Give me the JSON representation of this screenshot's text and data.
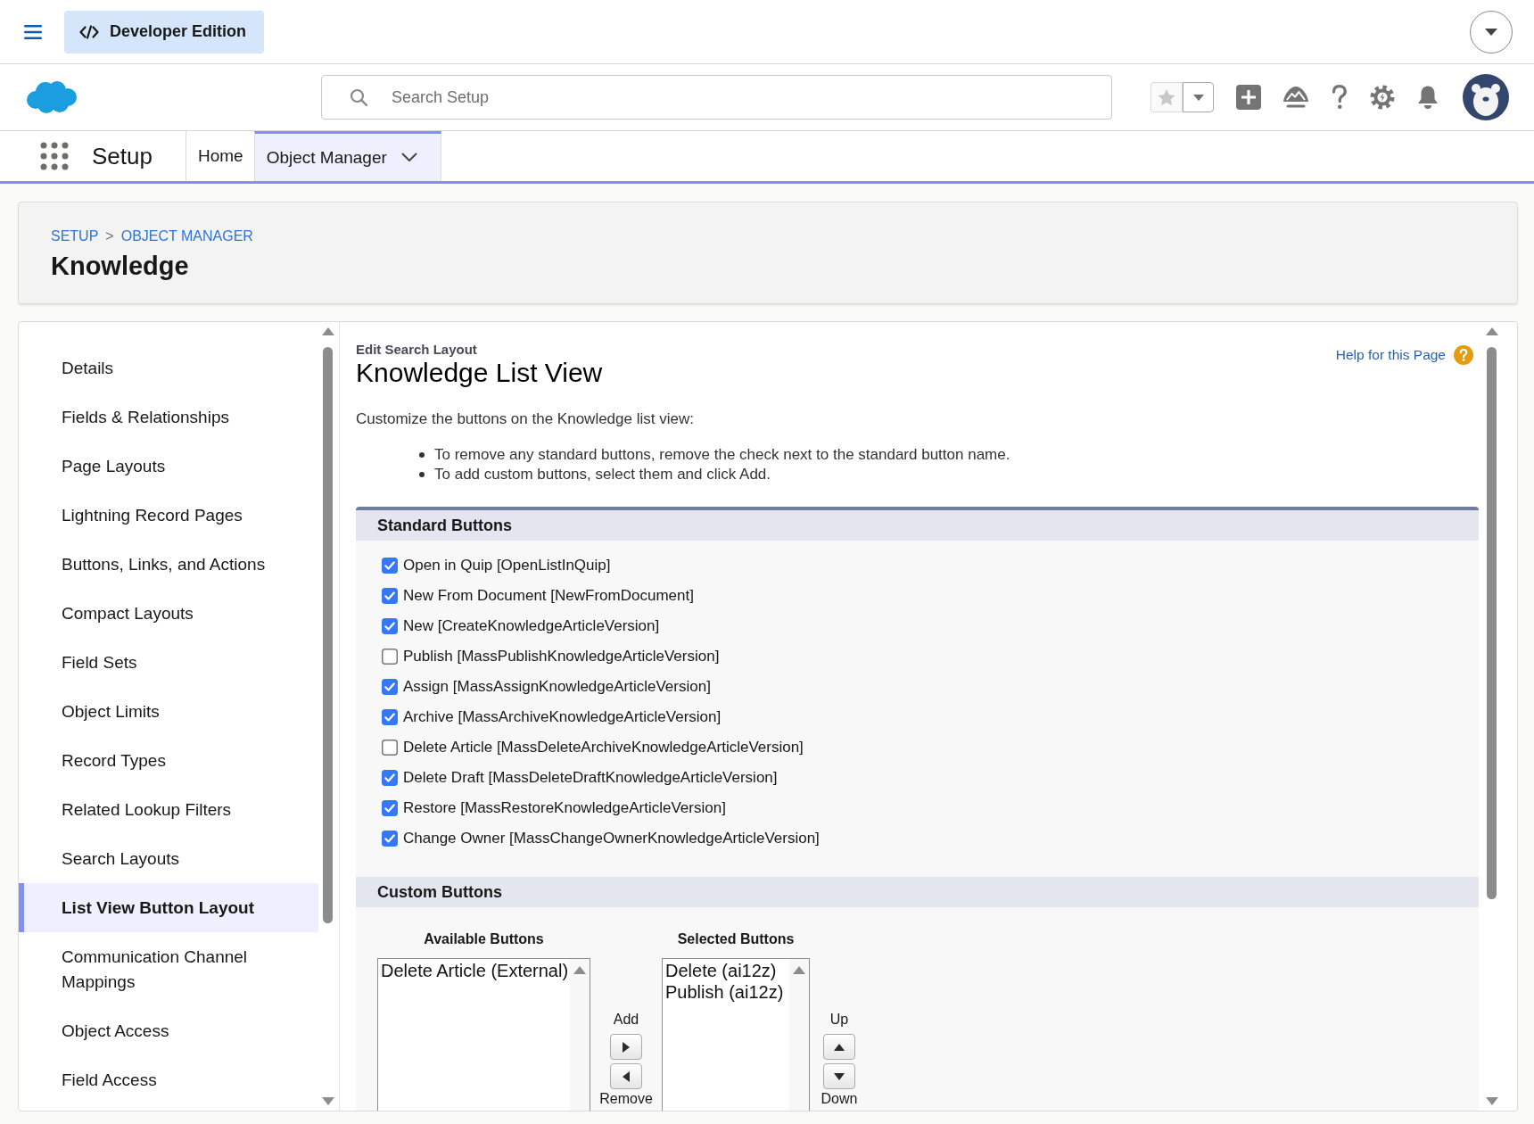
{
  "top_bar": {
    "edition": "Developer Edition"
  },
  "search": {
    "placeholder": "Search Setup"
  },
  "nav": {
    "app_name": "Setup",
    "tabs": [
      {
        "label": "Home",
        "selected": false,
        "dropdown": false
      },
      {
        "label": "Object Manager",
        "selected": true,
        "dropdown": true
      }
    ]
  },
  "page_header": {
    "breadcrumb": {
      "links": [
        "SETUP",
        "OBJECT MANAGER"
      ],
      "separator": ">"
    },
    "title": "Knowledge"
  },
  "sidebar": {
    "items": [
      {
        "label": "Details",
        "selected": false
      },
      {
        "label": "Fields & Relationships",
        "selected": false
      },
      {
        "label": "Page Layouts",
        "selected": false
      },
      {
        "label": "Lightning Record Pages",
        "selected": false
      },
      {
        "label": "Buttons, Links, and Actions",
        "selected": false
      },
      {
        "label": "Compact Layouts",
        "selected": false
      },
      {
        "label": "Field Sets",
        "selected": false
      },
      {
        "label": "Object Limits",
        "selected": false
      },
      {
        "label": "Record Types",
        "selected": false
      },
      {
        "label": "Related Lookup Filters",
        "selected": false
      },
      {
        "label": "Search Layouts",
        "selected": false
      },
      {
        "label": "List View Button Layout",
        "selected": true
      },
      {
        "label": "Communication Channel Mappings",
        "selected": false
      },
      {
        "label": "Object Access",
        "selected": false
      },
      {
        "label": "Field Access",
        "selected": false
      }
    ]
  },
  "content": {
    "eyebrow": "Edit Search Layout",
    "title": "Knowledge List View",
    "help_link": "Help for this Page",
    "intro": "Customize the buttons on the Knowledge list view:",
    "bullets": [
      "To remove any standard buttons, remove the check next to the standard button name.",
      "To add custom buttons, select them and click Add."
    ],
    "standard_buttons": {
      "title": "Standard Buttons",
      "items": [
        {
          "label": "Open in Quip [OpenListInQuip]",
          "checked": true
        },
        {
          "label": "New From Document [NewFromDocument]",
          "checked": true
        },
        {
          "label": "New [CreateKnowledgeArticleVersion]",
          "checked": true
        },
        {
          "label": "Publish [MassPublishKnowledgeArticleVersion]",
          "checked": false
        },
        {
          "label": "Assign [MassAssignKnowledgeArticleVersion]",
          "checked": true
        },
        {
          "label": "Archive [MassArchiveKnowledgeArticleVersion]",
          "checked": true
        },
        {
          "label": "Delete Article [MassDeleteArchiveKnowledgeArticleVersion]",
          "checked": false
        },
        {
          "label": "Delete Draft [MassDeleteDraftKnowledgeArticleVersion]",
          "checked": true
        },
        {
          "label": "Restore [MassRestoreKnowledgeArticleVersion]",
          "checked": true
        },
        {
          "label": "Change Owner [MassChangeOwnerKnowledgeArticleVersion]",
          "checked": true
        }
      ]
    },
    "custom_buttons": {
      "title": "Custom Buttons",
      "available": {
        "heading": "Available Buttons",
        "options": [
          "Delete Article (External)"
        ]
      },
      "add_label": "Add",
      "remove_label": "Remove",
      "selected": {
        "heading": "Selected Buttons",
        "options": [
          "Delete (ai12z)",
          "Publish (ai12z)"
        ]
      },
      "up_label": "Up",
      "down_label": "Down"
    }
  }
}
